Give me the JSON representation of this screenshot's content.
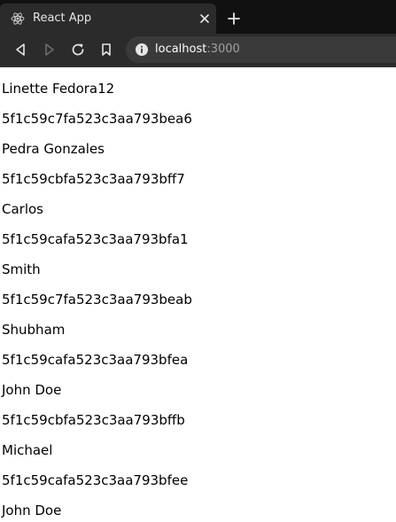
{
  "tab": {
    "title": "React App"
  },
  "address_bar": {
    "host": "localhost",
    "port": ":3000"
  },
  "users": [
    {
      "name": "Linette Fedora12",
      "id": "5f1c59c7fa523c3aa793bea6"
    },
    {
      "name": "Pedra Gonzales",
      "id": "5f1c59cbfa523c3aa793bff7"
    },
    {
      "name": "Carlos",
      "id": "5f1c59cafa523c3aa793bfa1"
    },
    {
      "name": "Smith",
      "id": "5f1c59c7fa523c3aa793beab"
    },
    {
      "name": "Shubham",
      "id": "5f1c59cafa523c3aa793bfea"
    },
    {
      "name": "John Doe",
      "id": "5f1c59cbfa523c3aa793bffb"
    },
    {
      "name": "Michael",
      "id": "5f1c59cafa523c3aa793bfee"
    },
    {
      "name": "John Doe"
    }
  ]
}
